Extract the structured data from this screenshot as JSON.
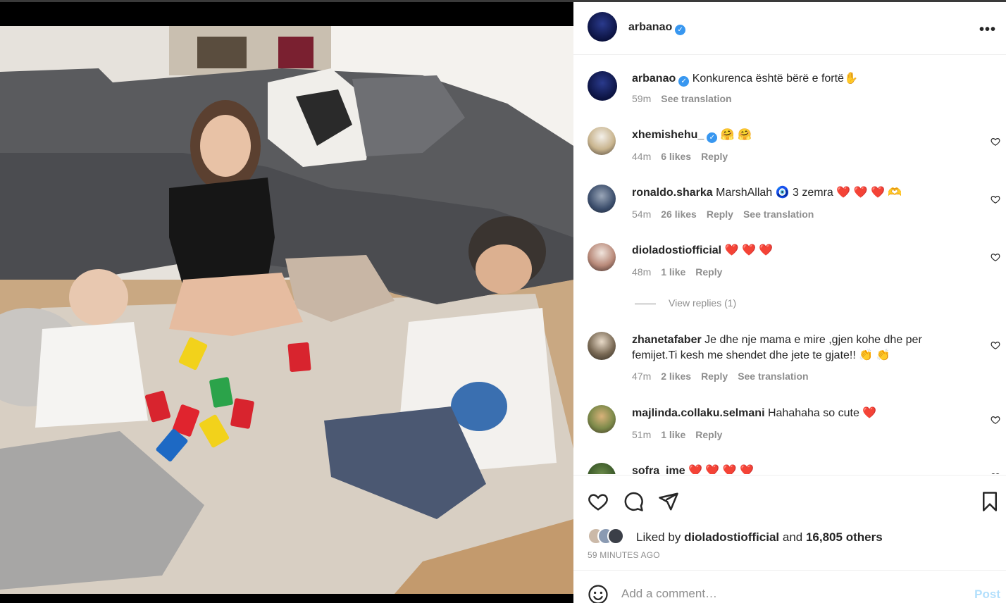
{
  "post": {
    "author": "arbanao",
    "more_icon": "more-horizontal-icon"
  },
  "caption": {
    "user": "arbanao",
    "text": "Konkurenca është bërë e fortë✋",
    "time": "59m",
    "translate": "See translation"
  },
  "comments": [
    {
      "user": "xhemishehu_",
      "verified": true,
      "text": "🤗 🤗",
      "time": "44m",
      "likes": "6 likes",
      "reply": "Reply",
      "translate": ""
    },
    {
      "user": "ronaldo.sharka",
      "verified": false,
      "text": "MarshAllah 🧿 3 zemra ❤️ ❤️ ❤️ 🫶",
      "time": "54m",
      "likes": "26 likes",
      "reply": "Reply",
      "translate": "See translation"
    },
    {
      "user": "dioladostiofficial",
      "verified": false,
      "text": "❤️ ❤️ ❤️",
      "time": "48m",
      "likes": "1 like",
      "reply": "Reply",
      "translate": ""
    },
    {
      "user": "zhanetafaber",
      "verified": false,
      "text": "Je dhe nje mama e mire ,gjen kohe dhe per femijet.Ti kesh me shendet dhe jete te gjate!! 👏 👏",
      "time": "47m",
      "likes": "2 likes",
      "reply": "Reply",
      "translate": "See translation"
    },
    {
      "user": "majlinda.collaku.selmani",
      "verified": false,
      "text": "Hahahaha so cute ❤️",
      "time": "51m",
      "likes": "1 like",
      "reply": "Reply",
      "translate": ""
    },
    {
      "user": "sofra_ime",
      "verified": false,
      "text": "❤️ ❤️ ❤️ ❤️",
      "time": "",
      "likes": "",
      "reply": "",
      "translate": ""
    }
  ],
  "view_replies": "View replies (1)",
  "likes": {
    "prefix": "Liked by",
    "user": "dioladostiofficial",
    "and": "and",
    "others": "16,805 others"
  },
  "time_ago": "59 MINUTES AGO",
  "add_comment": {
    "placeholder": "Add a comment…",
    "post_label": "Post"
  },
  "colors": {
    "verified": "#3897f0",
    "muted": "#8e8e8e",
    "post_button_disabled": "#b2dffc"
  }
}
